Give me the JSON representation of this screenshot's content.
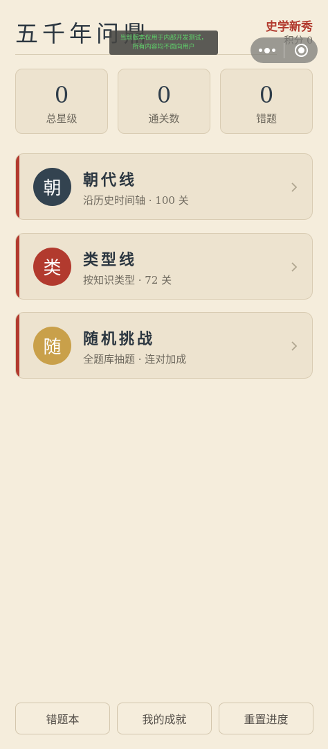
{
  "header": {
    "title": "五千年问鼎",
    "rank_title": "史学新秀",
    "score_label": "积分 0"
  },
  "dev_notice": {
    "line1": "当前版本仅用于内部开发测试，",
    "line2": "所有内容均不面向用户"
  },
  "capsule": {
    "more_icon": "more-dots-icon",
    "close_icon": "target-close-icon"
  },
  "stats": [
    {
      "value": "0",
      "label": "总星级"
    },
    {
      "value": "0",
      "label": "通关数"
    },
    {
      "value": "0",
      "label": "错题"
    }
  ],
  "modes": [
    {
      "badge": "朝",
      "title": "朝代线",
      "desc": "沿历史时间轴 · 100 关",
      "badge_color": "#334350"
    },
    {
      "badge": "类",
      "title": "类型线",
      "desc": "按知识类型 · 72 关",
      "badge_color": "#b23a2e"
    },
    {
      "badge": "随",
      "title": "随机挑战",
      "desc": "全题库抽题 · 连对加成",
      "badge_color": "#c9a04a"
    }
  ],
  "bottom_nav": [
    {
      "label": "错题本"
    },
    {
      "label": "我的成就"
    },
    {
      "label": "重置进度"
    }
  ],
  "colors": {
    "background": "#f5eddc",
    "card": "#ede3cf",
    "accent_red": "#b23a2e",
    "text_dark": "#2b3640"
  }
}
